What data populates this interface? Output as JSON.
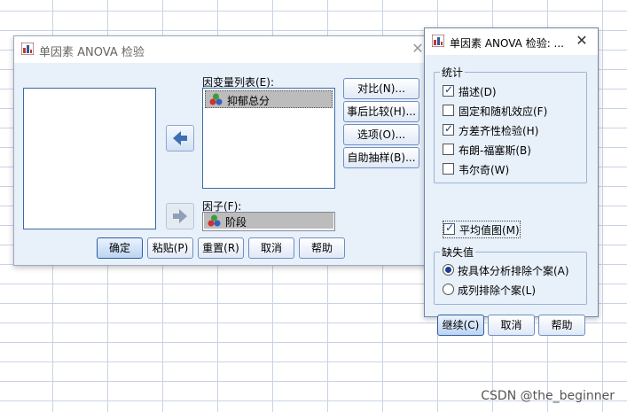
{
  "main_dialog": {
    "title": "单因素 ANOVA 检验",
    "close": "✕",
    "dependent_list_label": "因变量列表(E):",
    "dependent_items": [
      "抑郁总分"
    ],
    "factor_label": "因子(F):",
    "factor_value": "阶段",
    "side_buttons": [
      "对比(N)...",
      "事后比较(H)...",
      "选项(O)...",
      "自助抽样(B)..."
    ],
    "bottom_buttons": [
      "确定",
      "粘贴(P)",
      "重置(R)",
      "取消",
      "帮助"
    ]
  },
  "options_dialog": {
    "title": "单因素 ANOVA 检验: ...",
    "close": "✕",
    "statistics_group": "统计",
    "statistics": [
      {
        "label": "描述(D)",
        "checked": true
      },
      {
        "label": "固定和随机效应(F)",
        "checked": false
      },
      {
        "label": "方差齐性检验(H)",
        "checked": true
      },
      {
        "label": "布朗-福塞斯(B)",
        "checked": false
      },
      {
        "label": "韦尔奇(W)",
        "checked": false
      }
    ],
    "means_plot": {
      "label": "平均值图(M)",
      "checked": true
    },
    "missing_group": "缺失值",
    "missing_options": [
      {
        "label": "按具体分析排除个案(A)",
        "selected": true
      },
      {
        "label": "成列排除个案(L)",
        "selected": false
      }
    ],
    "buttons": [
      "继续(C)",
      "取消",
      "帮助"
    ]
  },
  "watermark": "CSDN @the_beginner",
  "colors": {
    "accent": "#2f5d9b",
    "dialog_bg": "#e8f0fa",
    "selected_item": "#bcbcbc"
  }
}
